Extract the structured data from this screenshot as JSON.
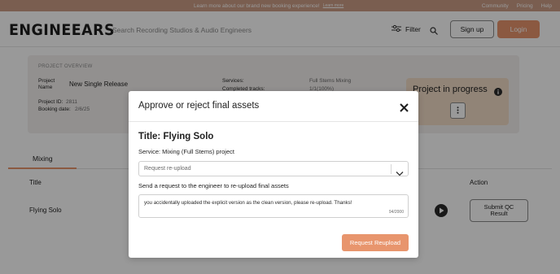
{
  "banner": {
    "text": "Learn more about our brand new booking experience!",
    "more": "Learn more",
    "links": [
      "Community",
      "Pricing",
      "Help"
    ]
  },
  "header": {
    "logo": "ENGINEEARS",
    "search_placeholder": "Search Recording Studios & Audio Engineers",
    "filter_label": "Filter",
    "signup_label": "Sign up",
    "login_label": "Login"
  },
  "overview": {
    "section_title": "PROJECT OVERVIEW",
    "project_name_label": "Project Name",
    "project_name_value": "New Single Release",
    "project_id_label": "Project ID:",
    "project_id_value": "2811",
    "booking_date_label": "Booking date:",
    "booking_date_value": "2/6/25",
    "services_label": "Services:",
    "services_value": "Full Stems Mixing",
    "completed_label": "Completed tracks:",
    "completed_value": "1/1(100%)",
    "status": "Project in progress"
  },
  "tabs": [
    "Mixing"
  ],
  "table": {
    "headers": {
      "title": "Title",
      "action": "Action"
    },
    "rows": [
      {
        "title": "Flying Solo",
        "action": "Submit QC Result"
      }
    ]
  },
  "modal": {
    "title": "Approve or reject final assets",
    "subtitle": "Title: Flying Solo",
    "service": "Service: Mixing (Full Stems) project",
    "select_value": "Request re-upload",
    "description": "Send a request to the engineer to re-upload final assets",
    "textarea_value": "you accidentally uploaded the explicit version as the clean version, please re-upload. Thanks!",
    "char_count": "94/2000",
    "submit_label": "Request Reupload"
  },
  "colors": {
    "accent": "#e8956d",
    "banner": "#cc9d86",
    "progress_card": "#f2dcc6",
    "overview_bg": "#f4f1ef"
  },
  "icons": [
    "filter-icon",
    "search-icon",
    "info-icon",
    "kebab-menu-icon",
    "play-icon",
    "close-icon",
    "chevron-down-icon"
  ]
}
